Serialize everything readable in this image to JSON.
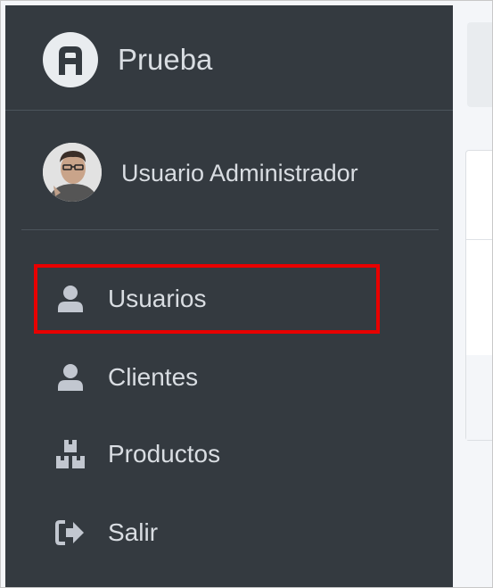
{
  "brand": {
    "name": "Prueba",
    "logo_icon": "letter-a-logo-icon"
  },
  "user": {
    "name": "Usuario Administrador",
    "avatar_icon": "user-avatar-photo"
  },
  "nav": {
    "items": [
      {
        "label": "Usuarios",
        "icon": "user-icon",
        "highlighted": true
      },
      {
        "label": "Clientes",
        "icon": "user-icon"
      },
      {
        "label": "Productos",
        "icon": "boxes-icon"
      },
      {
        "label": "Salir",
        "icon": "sign-out-icon"
      }
    ]
  },
  "colors": {
    "sidebar_bg": "#343a40",
    "text": "#d9dde2",
    "highlight_border": "#e80000",
    "content_bg": "#f4f6f9"
  }
}
